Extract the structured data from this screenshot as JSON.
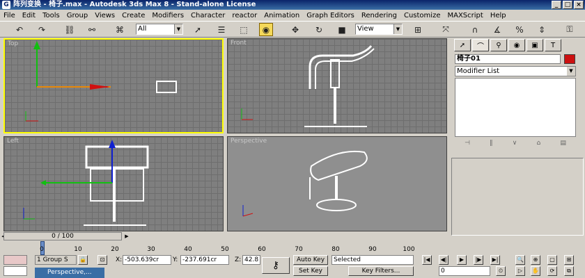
{
  "window": {
    "title": "阵列变换 - 椅子.max - Autodesk 3ds Max 8 - Stand-alone License",
    "app_icon": "3ds-max-icon",
    "controls": [
      "_",
      "□",
      "×"
    ]
  },
  "menu": [
    "File",
    "Edit",
    "Tools",
    "Group",
    "Views",
    "Create",
    "Modifiers",
    "Character",
    "reactor",
    "Animation",
    "Graph Editors",
    "Rendering",
    "Customize",
    "MAXScript",
    "Help"
  ],
  "toolbar": {
    "selection_filter": "All",
    "ref_coord": "View",
    "icons": [
      "undo-icon",
      "redo-icon",
      "select-link-icon",
      "unlink-icon",
      "bind-spacewarp-icon",
      "select-object-icon",
      "select-by-name-icon",
      "rect-region-icon",
      "window-crossing-icon",
      "move-icon",
      "rotate-icon",
      "scale-icon",
      "pivot-icon",
      "mirror-icon",
      "align-icon",
      "snap-icon",
      "angle-snap-icon",
      "percent-snap-icon",
      "spinner-snap-icon",
      "named-sel-icon",
      "render-icon"
    ]
  },
  "viewports": {
    "top": {
      "label": "Top",
      "active": true
    },
    "front": {
      "label": "Front",
      "active": false
    },
    "left": {
      "label": "Left",
      "active": false
    },
    "perspective": {
      "label": "Perspective",
      "active": false
    }
  },
  "command_panel": {
    "tabs": [
      "create-icon",
      "modify-icon",
      "hierarchy-icon",
      "motion-icon",
      "display-icon",
      "utilities-icon"
    ],
    "object_name": "椅子01",
    "object_color": "#cc1010",
    "modifier_list": "Modifier List"
  },
  "time": {
    "slider": "0 / 100",
    "ticks": [
      "0",
      "10",
      "20",
      "30",
      "40",
      "50",
      "60",
      "70",
      "80",
      "90",
      "100"
    ]
  },
  "status": {
    "selection": "1 Group S",
    "x_label": "X:",
    "x": "-503.639cr",
    "y_label": "Y:",
    "y": "-237.691cr",
    "z_label": "Z:",
    "z": "42.8",
    "auto_key": "Auto Key",
    "set_key": "Set Key",
    "key_mode": "Selected",
    "key_filters": "Key Filters...",
    "frame": "0",
    "taskbar": "Perspective,..."
  }
}
